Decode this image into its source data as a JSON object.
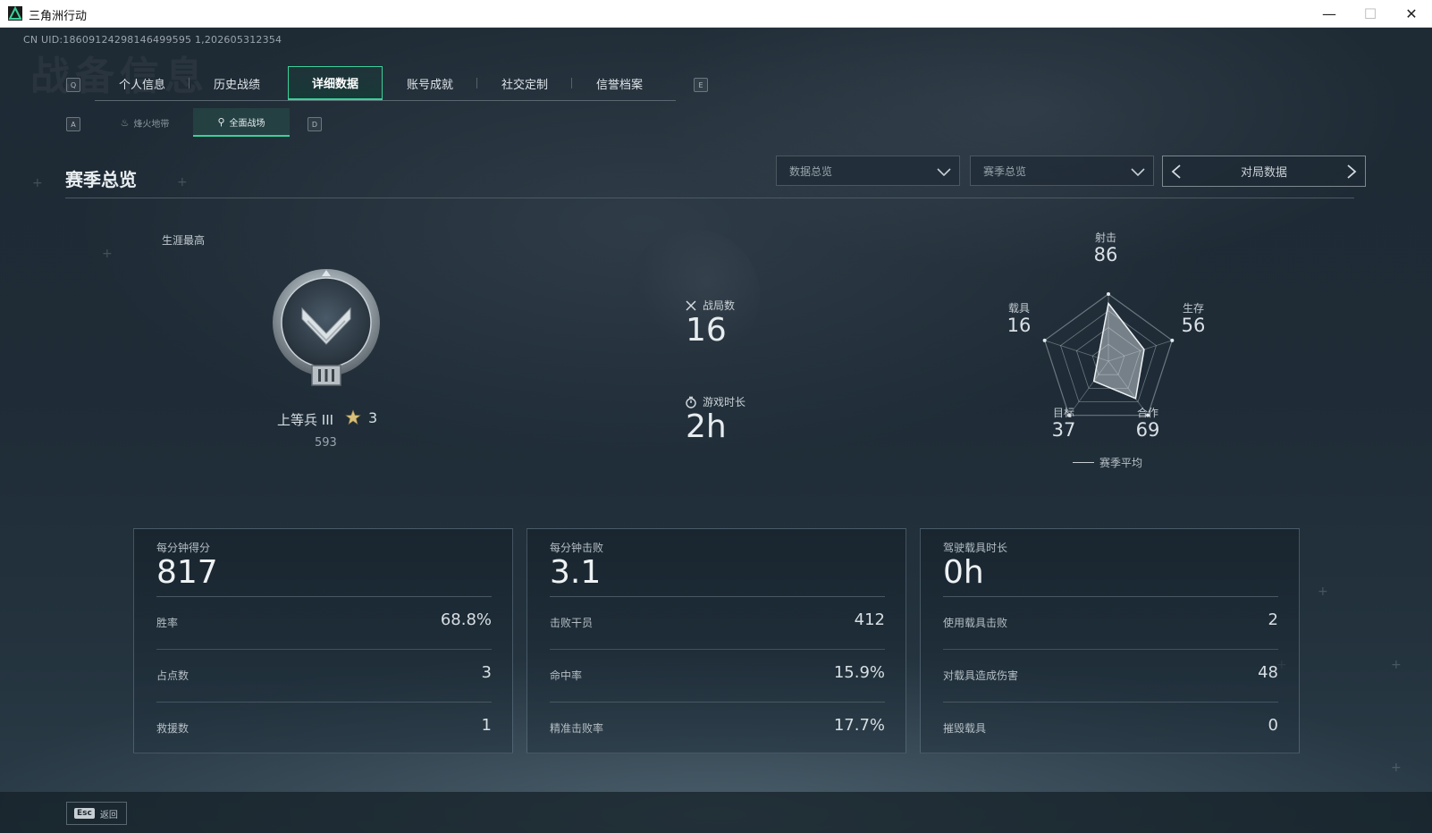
{
  "window": {
    "title": "三角洲行动",
    "min_glyph": "—",
    "max_glyph": "☐",
    "close_glyph": "✕"
  },
  "uid": "CN UID:18609124298146499595 1,202605312354",
  "background_title": "战备信息",
  "main_tabs": {
    "left_key": "Q",
    "right_key": "E",
    "items": [
      {
        "label": "个人信息"
      },
      {
        "label": "历史战绩"
      },
      {
        "label": "详细数据",
        "active": true
      },
      {
        "label": "账号成就"
      },
      {
        "label": "社交定制"
      },
      {
        "label": "信誉档案"
      }
    ]
  },
  "sub_tabs": {
    "left_key": "A",
    "right_key": "D",
    "items": [
      {
        "label": "烽火地带",
        "icon": "flame-icon"
      },
      {
        "label": "全面战场",
        "icon": "parachute-icon",
        "active": true
      }
    ]
  },
  "section": {
    "title": "赛季总览",
    "dropdown1": "数据总览",
    "dropdown2": "赛季总览",
    "pager": "对局数据"
  },
  "career": {
    "label": "生涯最高",
    "rank_name": "上等兵 III",
    "star_count": "3",
    "score": "593"
  },
  "summary": {
    "matches_label": "战局数",
    "matches_value": "16",
    "playtime_label": "游戏时长",
    "playtime_value": "2h"
  },
  "radar": {
    "axes": [
      {
        "label": "射击",
        "value": "86"
      },
      {
        "label": "生存",
        "value": "56"
      },
      {
        "label": "合作",
        "value": "69"
      },
      {
        "label": "目标",
        "value": "37"
      },
      {
        "label": "载具",
        "value": "16"
      }
    ],
    "legend": "赛季平均"
  },
  "cards": [
    {
      "title": "每分钟得分",
      "value": "817",
      "rows": [
        {
          "label": "胜率",
          "value": "68.8%"
        },
        {
          "label": "占点数",
          "value": "3"
        },
        {
          "label": "救援数",
          "value": "1"
        }
      ]
    },
    {
      "title": "每分钟击败",
      "value": "3.1",
      "rows": [
        {
          "label": "击败干员",
          "value": "412"
        },
        {
          "label": "命中率",
          "value": "15.9%"
        },
        {
          "label": "精准击败率",
          "value": "17.7%"
        }
      ]
    },
    {
      "title": "驾驶载具时长",
      "value": "0h",
      "rows": [
        {
          "label": "使用载具击败",
          "value": "2"
        },
        {
          "label": "对载具造成伤害",
          "value": "48"
        },
        {
          "label": "摧毁载具",
          "value": "0"
        }
      ]
    }
  ],
  "bottom": {
    "esc_key": "Esc",
    "back_label": "返回"
  },
  "colors": {
    "accent": "#3bd19a",
    "background": "#1b2731"
  }
}
